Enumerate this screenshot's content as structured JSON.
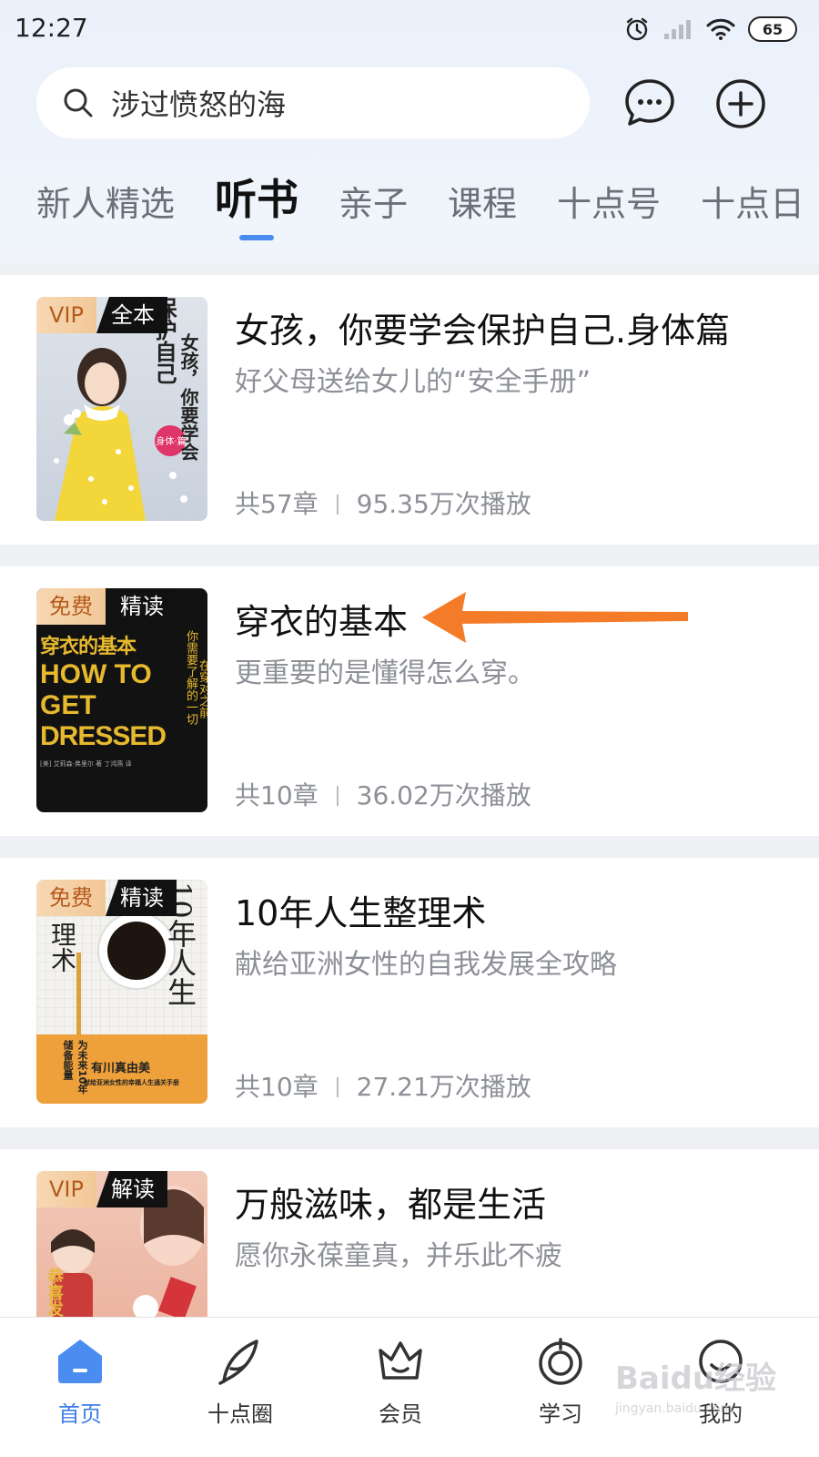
{
  "status_bar": {
    "time": "12:27",
    "battery": "65",
    "icons": [
      "alarm-icon",
      "signal-icon",
      "wifi-icon",
      "battery-icon"
    ]
  },
  "search": {
    "value": "涉过愤怒的海"
  },
  "top_buttons": [
    "message-icon",
    "add-icon"
  ],
  "tabs": [
    {
      "label": "新人精选",
      "active": false
    },
    {
      "label": "听书",
      "active": true
    },
    {
      "label": "亲子",
      "active": false
    },
    {
      "label": "课程",
      "active": false
    },
    {
      "label": "十点号",
      "active": false
    },
    {
      "label": "十点日",
      "active": false
    }
  ],
  "books": [
    {
      "badge_left": "VIP",
      "badge_right": "全本",
      "title": "女孩，你要学会保护自己.身体篇",
      "subtitle": "好父母送给女儿的“安全手册”",
      "chapters": "共57章",
      "plays": "95.35万次播放",
      "cover_text": [
        "女孩，你要学会",
        "保护自己",
        "身体·篇"
      ]
    },
    {
      "badge_left": "免费",
      "badge_right": "精读",
      "title": "穿衣的基本",
      "subtitle": "更重要的是懂得怎么穿。",
      "chapters": "共10章",
      "plays": "36.02万次播放",
      "cover_text": [
        "穿衣的基本",
        "HOW TO",
        "GET",
        "DRESSED",
        "你需要了解的一切",
        "在穿对之前",
        "[美] 艾莉森·弗里尔 著  丁鸿燕 译"
      ]
    },
    {
      "badge_left": "免费",
      "badge_right": "精读",
      "title": "10年人生整理术",
      "subtitle": "献给亚洲女性的自我发展全攻略",
      "chapters": "共10章",
      "plays": "27.21万次播放",
      "cover_text": [
        "10年人生",
        "理术",
        "为未来10年储备能量",
        "有川真由美",
        "献给亚洲女性的幸福人生通关手册"
      ]
    },
    {
      "badge_left": "VIP",
      "badge_right": "解读",
      "title": "万般滋味，都是生活",
      "subtitle": "愿你永葆童真，并乐此不疲",
      "cover_text": [
        "恭喜发财"
      ]
    }
  ],
  "annotation": {
    "type": "arrow",
    "color": "#f47b28"
  },
  "bottom_nav": [
    {
      "label": "首页",
      "icon": "home-icon",
      "active": true
    },
    {
      "label": "十点圈",
      "icon": "feather-icon",
      "active": false
    },
    {
      "label": "会员",
      "icon": "crown-icon",
      "active": false
    },
    {
      "label": "学习",
      "icon": "study-icon",
      "active": false
    },
    {
      "label": "我的",
      "icon": "profile-icon",
      "active": false
    }
  ],
  "watermark": {
    "text": "Baidu经验",
    "sub": "jingyan.baidu.com"
  },
  "colors": {
    "accent": "#3f7ee8",
    "badge_vip_bg": "#f4d3ab",
    "badge_vip_text": "#b65a1c",
    "arrow": "#f47b28"
  }
}
